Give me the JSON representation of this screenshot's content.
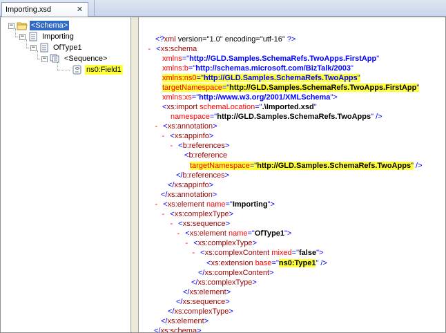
{
  "tab": {
    "label": "Importing.xsd",
    "close_symbol": "✕"
  },
  "tree": {
    "nodes": [
      {
        "label": "<Schema>",
        "expander": "−"
      },
      {
        "label": "Importing",
        "expander": "−"
      },
      {
        "label": "OfType1",
        "expander": "−"
      },
      {
        "label": "<Sequence>",
        "expander": "−"
      },
      {
        "prefix": "ns0:",
        "label": "Field1"
      }
    ]
  },
  "xml": {
    "decl": {
      "prefix": "<?",
      "name": "xml",
      "body": " version=\"1.0\" encoding=\"utf-16\" ",
      "suffix": "?>"
    },
    "schema_tag": "xs:schema",
    "xmlns_attr": "xmlns",
    "xmlns_val": "http://GLD.Samples.SchemaRefs.TwoApps.FirstApp",
    "xmlns_b_attr": "xmlns:b",
    "xmlns_b_val": "http://schemas.microsoft.com/BizTalk/2003",
    "xmlns_ns0_attr": "xmlns:ns0",
    "xmlns_ns0_val": "http://GLD.Samples.SchemaRefs.TwoApps",
    "tns_attr": "targetNamespace",
    "tns_val": "http://GLD.Samples.SchemaRefs.TwoApps.FirstApp",
    "xmlns_xs_attr": "xmlns:xs",
    "xmlns_xs_val": "http://www.w3.org/2001/XMLSchema",
    "import_tag": "xs:import",
    "import_loc_attr": "schemaLocation",
    "import_loc_val": ".\\Imported.xsd",
    "import_ns_attr": "namespace",
    "import_ns_val": "http://GLD.Samples.SchemaRefs.TwoApps",
    "annotation_tag": "xs:annotation",
    "appinfo_tag": "xs:appinfo",
    "references_tag": "b:references",
    "reference_tag": "b:reference",
    "ref_tns_attr": "targetNamespace",
    "ref_tns_val": "http://GLD.Samples.SchemaRefs.TwoApps",
    "element_tag": "xs:element",
    "name_attr": "name",
    "element1_name": "Importing",
    "complexType_tag": "xs:complexType",
    "sequence_tag": "xs:sequence",
    "element2_name": "OfType1",
    "complexContent_tag": "xs:complexContent",
    "mixed_attr": "mixed",
    "mixed_val": "false",
    "extension_tag": "xs:extension",
    "base_attr": "base",
    "base_val": "ns0:Type1"
  },
  "colors": {
    "highlight": "#ffff3a",
    "selection": "#316ac5",
    "minus": "#ff0000",
    "punct": "#0000ff",
    "tag": "#990000"
  }
}
